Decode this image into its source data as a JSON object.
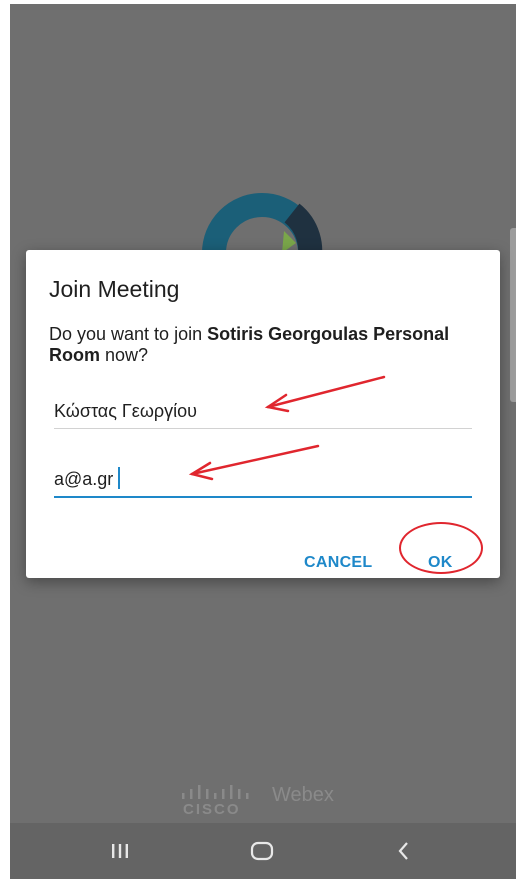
{
  "dialog": {
    "title": "Join Meeting",
    "message_prefix": "Do you want to join ",
    "room_name": "Sotiris Georgoulas Personal Room",
    "message_suffix": " now?",
    "name_value": "Κώστας Γεωργίου",
    "email_value": "a@a.gr",
    "cancel_label": "CANCEL",
    "ok_label": "OK"
  },
  "branding": {
    "cisco": "CISCO",
    "product": "Webex"
  },
  "colors": {
    "accent": "#1e88c9",
    "annotation": "#e0262e",
    "overlay": "#6f6f6f"
  },
  "icons": {
    "logo": "webex-logo-icon",
    "recent_apps": "recent-apps-icon",
    "home": "home-icon",
    "back": "back-icon"
  }
}
